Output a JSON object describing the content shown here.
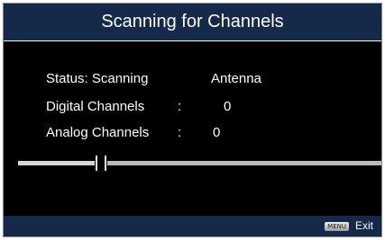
{
  "title": "Scanning for Channels",
  "status": {
    "label": "Status: Scanning",
    "value": "Antenna"
  },
  "digital": {
    "label": "Digital Channels",
    "separator": ":",
    "value": "0"
  },
  "analog": {
    "label": "Analog Channels",
    "separator": ":",
    "value": "0"
  },
  "progress": {
    "fraction": 0.22
  },
  "footer": {
    "menu_key_label": "MENU",
    "exit_label": "Exit"
  },
  "colors": {
    "background": "#000000",
    "bar": "#15294a",
    "text": "#ffffff",
    "progress_track": "#bdbdbd"
  }
}
